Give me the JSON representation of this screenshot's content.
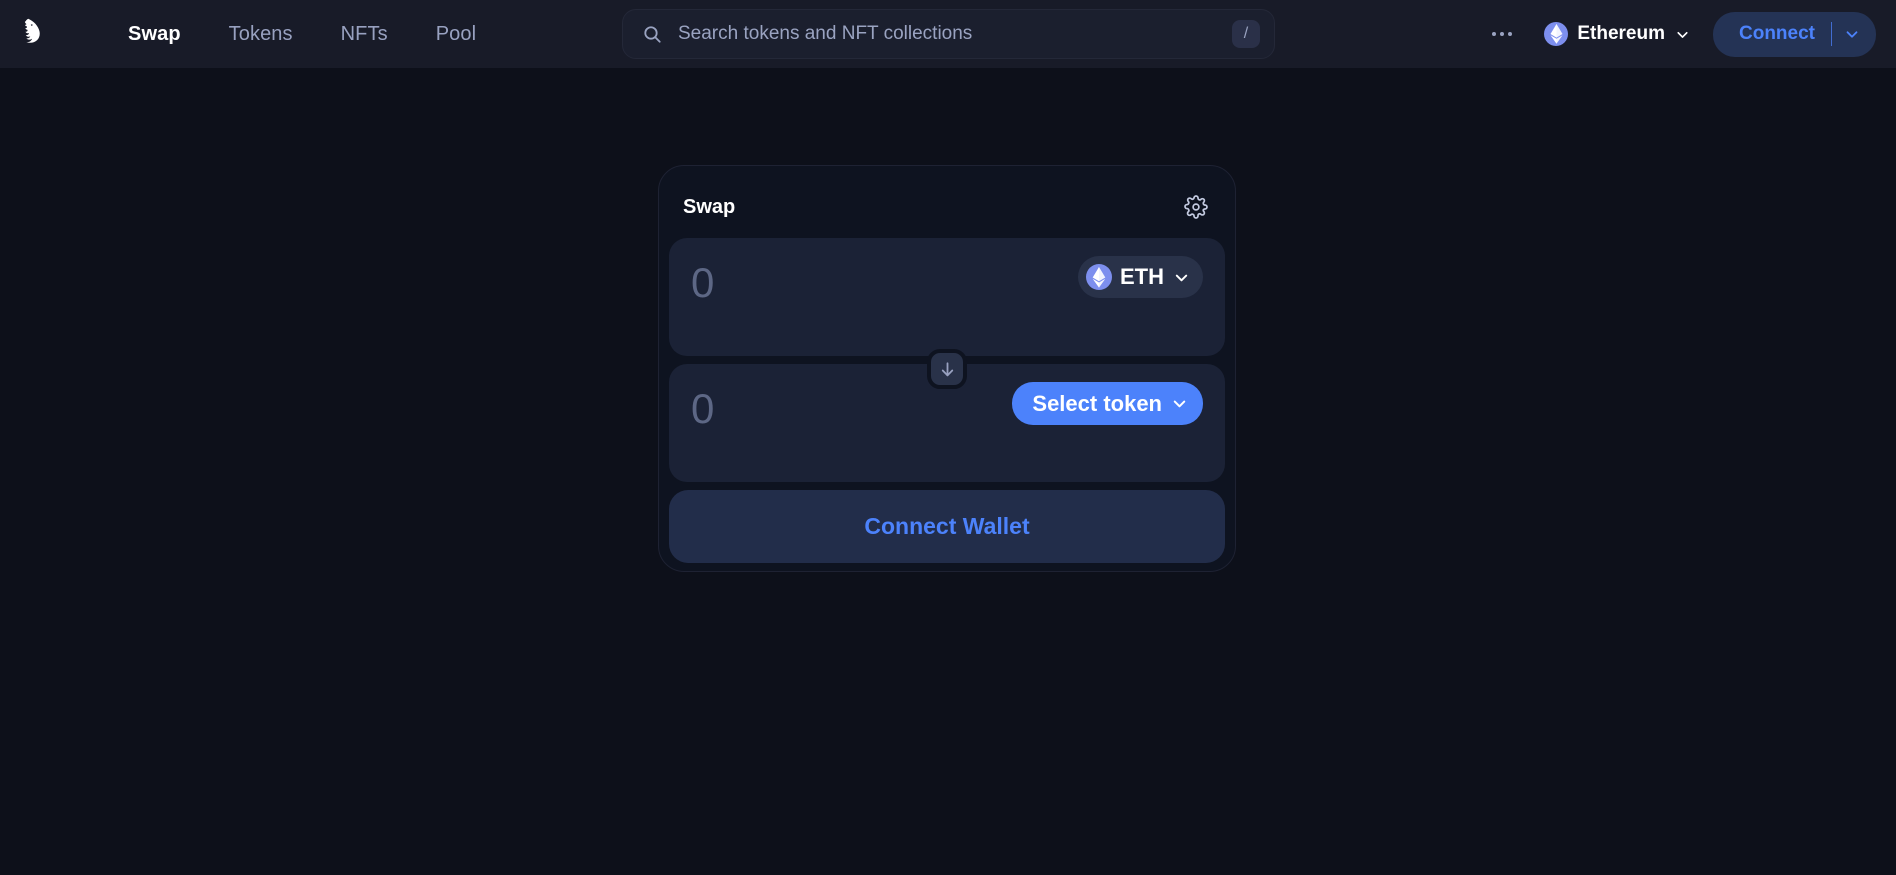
{
  "header": {
    "logo_icon": "uniswap-unicorn-logo",
    "nav": [
      {
        "label": "Swap",
        "active": true
      },
      {
        "label": "Tokens",
        "active": false
      },
      {
        "label": "NFTs",
        "active": false
      },
      {
        "label": "Pool",
        "active": false
      }
    ],
    "search": {
      "icon": "search-icon",
      "placeholder": "Search tokens and NFT collections",
      "value": "",
      "shortcut_key": "/"
    },
    "more_menu_icon": "ellipsis-horizontal-icon",
    "chain_selector": {
      "label": "Ethereum",
      "logo_icon": "ethereum-logo",
      "chevron_icon": "chevron-down-icon"
    },
    "connect": {
      "label": "Connect",
      "chevron_icon": "chevron-down-icon"
    }
  },
  "swap_card": {
    "title": "Swap",
    "settings_icon": "gear-icon",
    "input_field": {
      "value": "",
      "placeholder": "0",
      "token": {
        "symbol": "ETH",
        "logo_icon": "ethereum-logo",
        "chevron_icon": "chevron-down-icon",
        "selected": true
      }
    },
    "swap_direction_icon": "arrow-down-icon",
    "output_field": {
      "value": "",
      "placeholder": "0",
      "token": {
        "symbol": "Select token",
        "logo_icon": "",
        "chevron_icon": "chevron-down-icon",
        "selected": false
      }
    },
    "action_button": {
      "label": "Connect Wallet"
    }
  },
  "colors": {
    "page_background": "#0D101A",
    "header_background": "#181B28",
    "card_background": "#0E1320",
    "panel_background": "#1B2236",
    "accent_blue": "#4C82FB",
    "accent_blue_muted": "#243355",
    "text_primary": "#FFFFFF",
    "text_secondary": "#98A1C0",
    "placeholder": "#5D6785",
    "eth_logo_circle": "#7D8FEE"
  }
}
